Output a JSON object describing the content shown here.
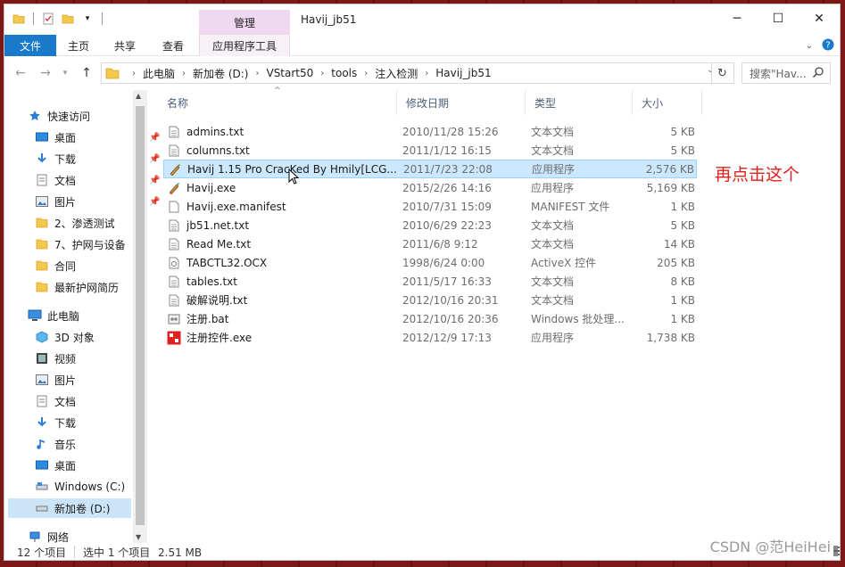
{
  "window": {
    "title": "Havij_jb51",
    "context_tab": "管理",
    "buttons": {
      "min": "─",
      "max": "☐",
      "close": "✕"
    }
  },
  "ribbon": {
    "tabs": [
      "文件",
      "主页",
      "共享",
      "查看",
      "应用程序工具"
    ]
  },
  "address": {
    "crumbs": [
      "此电脑",
      "新加卷 (D:)",
      "VStart50",
      "tools",
      "注入检测",
      "Havij_jb51"
    ],
    "search_placeholder": "搜索\"Hav..."
  },
  "sidebar": {
    "items": [
      {
        "label": "快速访问",
        "icon": "star-icon"
      },
      {
        "label": "桌面",
        "icon": "desktop-icon"
      },
      {
        "label": "下载",
        "icon": "download-icon"
      },
      {
        "label": "文档",
        "icon": "document-icon"
      },
      {
        "label": "图片",
        "icon": "picture-icon"
      },
      {
        "label": "2、渗透测试",
        "icon": "folder-icon"
      },
      {
        "label": "7、护网与设备",
        "icon": "folder-icon"
      },
      {
        "label": "合同",
        "icon": "folder-icon"
      },
      {
        "label": "最新护网简历",
        "icon": "folder-icon"
      },
      {
        "label": "此电脑",
        "icon": "computer-icon"
      },
      {
        "label": "3D 对象",
        "icon": "3d-objects-icon"
      },
      {
        "label": "视频",
        "icon": "video-icon"
      },
      {
        "label": "图片",
        "icon": "picture-icon"
      },
      {
        "label": "文档",
        "icon": "document-icon"
      },
      {
        "label": "下载",
        "icon": "download-icon"
      },
      {
        "label": "音乐",
        "icon": "music-icon"
      },
      {
        "label": "桌面",
        "icon": "desktop-icon"
      },
      {
        "label": "Windows (C:)",
        "icon": "drive-icon"
      },
      {
        "label": "新加卷 (D:)",
        "icon": "drive-icon"
      },
      {
        "label": "网络",
        "icon": "network-icon"
      }
    ]
  },
  "columns": [
    "名称",
    "修改日期",
    "类型",
    "大小"
  ],
  "files": [
    {
      "name": "admins.txt",
      "date": "2010/11/28 15:26",
      "type": "文本文档",
      "size": "5 KB",
      "icon": "text-file-icon"
    },
    {
      "name": "columns.txt",
      "date": "2011/1/12 16:15",
      "type": "文本文档",
      "size": "5 KB",
      "icon": "text-file-icon"
    },
    {
      "name": "Havij 1.15 Pro CracKed By Hmily[LCG...",
      "date": "2011/7/23 22:08",
      "type": "应用程序",
      "size": "2,576 KB",
      "icon": "havij-app-icon"
    },
    {
      "name": "Havij.exe",
      "date": "2015/2/26 14:16",
      "type": "应用程序",
      "size": "5,169 KB",
      "icon": "havij-app-icon"
    },
    {
      "name": "Havij.exe.manifest",
      "date": "2010/7/31 15:09",
      "type": "MANIFEST 文件",
      "size": "1 KB",
      "icon": "blank-file-icon"
    },
    {
      "name": "jb51.net.txt",
      "date": "2010/6/29 22:23",
      "type": "文本文档",
      "size": "5 KB",
      "icon": "text-file-icon"
    },
    {
      "name": "Read Me.txt",
      "date": "2011/6/8 9:12",
      "type": "文本文档",
      "size": "14 KB",
      "icon": "text-file-icon"
    },
    {
      "name": "TABCTL32.OCX",
      "date": "1998/6/24 0:00",
      "type": "ActiveX 控件",
      "size": "205 KB",
      "icon": "activex-icon"
    },
    {
      "name": "tables.txt",
      "date": "2011/5/17 16:33",
      "type": "文本文档",
      "size": "8 KB",
      "icon": "text-file-icon"
    },
    {
      "name": "破解说明.txt",
      "date": "2012/10/16 20:31",
      "type": "文本文档",
      "size": "1 KB",
      "icon": "text-file-icon"
    },
    {
      "name": "注册.bat",
      "date": "2012/10/16 20:36",
      "type": "Windows 批处理...",
      "size": "1 KB",
      "icon": "batch-file-icon"
    },
    {
      "name": "注册控件.exe",
      "date": "2012/12/9 17:13",
      "type": "应用程序",
      "size": "1,738 KB",
      "icon": "register-app-icon"
    }
  ],
  "annotation": "再点击这个",
  "status": {
    "count": "12 个项目",
    "selected": "选中 1 个项目",
    "size": "2.51 MB"
  },
  "watermark": "CSDN @范HeiHei",
  "colors": {
    "accent": "#1979ca",
    "selected_row": "#cce8ff",
    "annotation": "#e0201c",
    "context_tab": "#f0d8f0"
  }
}
